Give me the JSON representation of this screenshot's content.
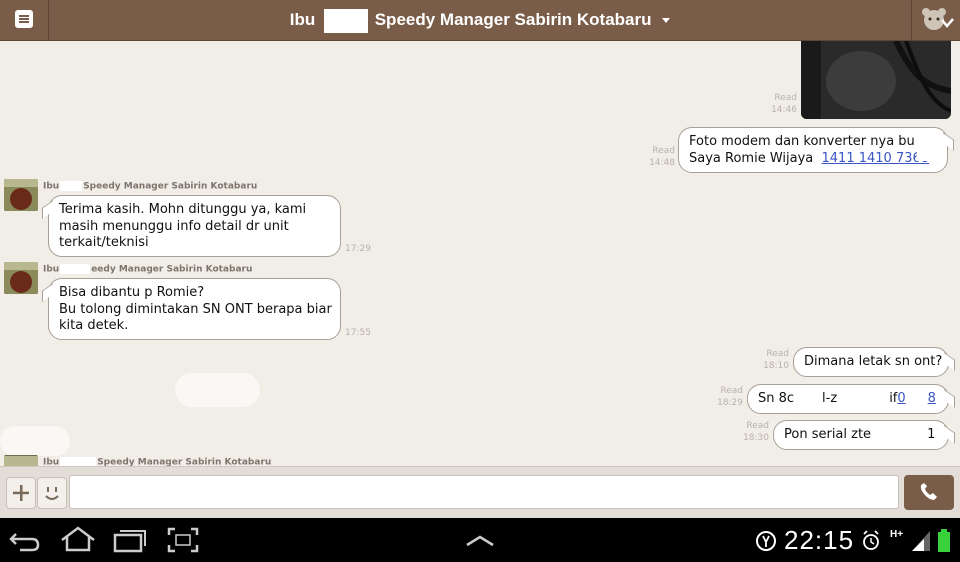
{
  "header": {
    "title_prefix": "Ibu",
    "title_suffix": "Speedy Manager Sabirin Kotabaru"
  },
  "messages": {
    "photo_read": "Read",
    "photo_time": "14:46",
    "m1": {
      "read": "Read",
      "time": "14:48",
      "line1": "Foto modem dan konverter nya bu I",
      "line2_text": "Saya Romie Wijaya",
      "line2_link": "1411 1410 7368"
    },
    "m2": {
      "sender": "Ibu",
      "sender_suffix": "Speedy Manager Sabirin Kotabaru",
      "line1": "Terima kasih. Mohn ditunggu ya, kami",
      "line2": "masih menunggu info detail dr unit",
      "line3": "terkait/teknisi",
      "time": "17:29"
    },
    "m3": {
      "sender": "Ibu",
      "sender_suffix": "eedy Manager Sabirin Kotabaru",
      "line1": "Bisa dibantu p Romie?",
      "line2": "Bu tolong dimintakan SN ONT berapa biar",
      "line3": "kita detek.",
      "time": "17:55"
    },
    "m4": {
      "read": "Read",
      "time": "18:10",
      "text": "Dimana letak sn ont?"
    },
    "m5": {
      "read": "Read",
      "time": "18:29",
      "text_a": "Sn  8c",
      "text_b": "l-z",
      "text_c": "if",
      "text_link_a": "0",
      "text_link_b": "8"
    },
    "m6": {
      "read": "Read",
      "time": "18:30",
      "text_a": "Pon serial zte",
      "text_b": "1"
    },
    "m7": {
      "sender": "Ibu",
      "sender_suffix": "Speedy Manager Sabirin Kotabaru"
    }
  },
  "input": {
    "value": "",
    "placeholder": ""
  },
  "statusbar": {
    "time": "22:15",
    "network": "H+"
  },
  "colors": {
    "header": "#7a5d49",
    "chat_bg": "#f1ede7",
    "link": "#3a55c4"
  },
  "icons": [
    "menu-icon",
    "bear-icon",
    "plus-icon",
    "emoticon-icon",
    "phone-icon",
    "back-icon",
    "home-icon",
    "recent-apps-icon",
    "screenshot-icon",
    "up-arrow-icon",
    "usb-debug-icon",
    "alarm-icon",
    "signal-icon",
    "battery-icon"
  ]
}
